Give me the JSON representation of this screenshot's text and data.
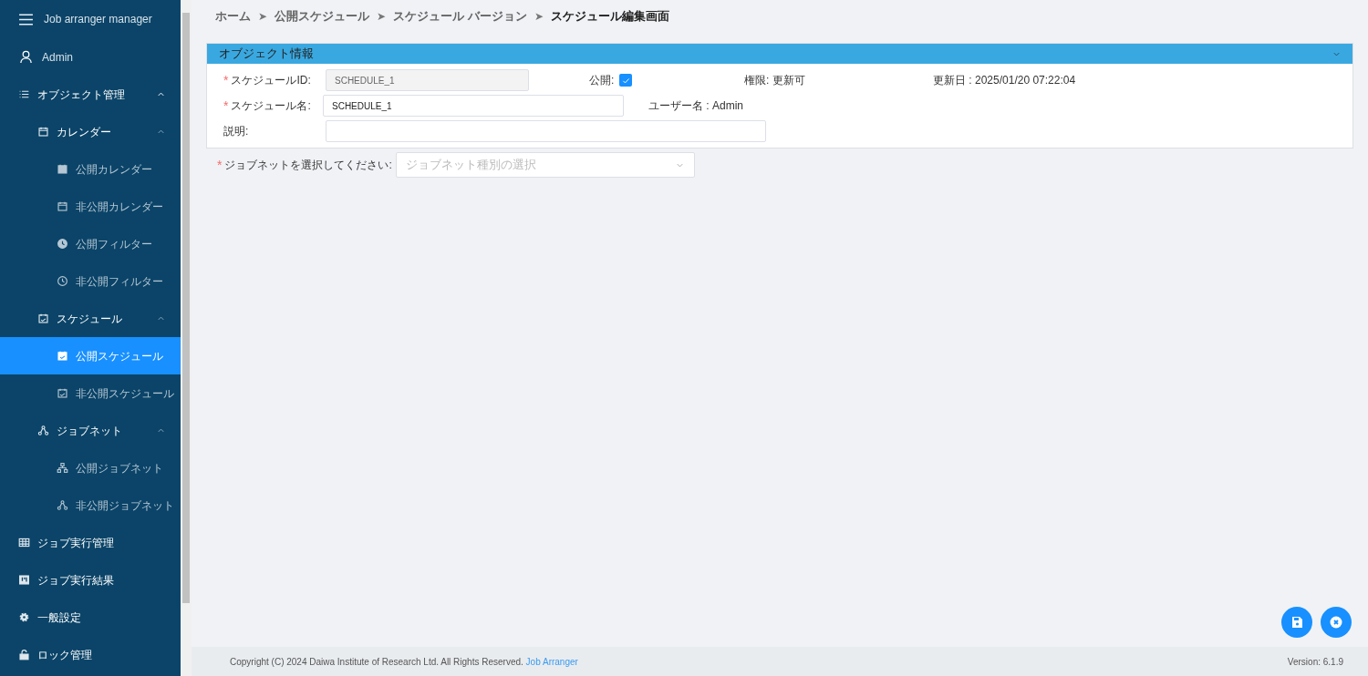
{
  "sidebar": {
    "title": "Job arranger manager",
    "user": "Admin",
    "items": [
      {
        "label": "オブジェクト管理",
        "kind": "list",
        "expanded": true,
        "selected": false,
        "children": [
          {
            "label": "カレンダー",
            "kind": "calendar",
            "expanded": true,
            "selected": false,
            "children": [
              {
                "label": "公開カレンダー",
                "kind": "calendar-filled",
                "selected": false
              },
              {
                "label": "非公開カレンダー",
                "kind": "calendar",
                "selected": false
              },
              {
                "label": "公開フィルター",
                "kind": "clock-filled",
                "selected": false
              },
              {
                "label": "非公開フィルター",
                "kind": "clock",
                "selected": false
              }
            ]
          },
          {
            "label": "スケジュール",
            "kind": "schedule",
            "expanded": true,
            "selected": false,
            "children": [
              {
                "label": "公開スケジュール",
                "kind": "schedule-filled",
                "selected": true
              },
              {
                "label": "非公開スケジュール",
                "kind": "schedule",
                "selected": false
              }
            ]
          },
          {
            "label": "ジョブネット",
            "kind": "network",
            "expanded": true,
            "selected": false,
            "children": [
              {
                "label": "公開ジョブネット",
                "kind": "hierarchy",
                "selected": false
              },
              {
                "label": "非公開ジョブネット",
                "kind": "network",
                "selected": false
              }
            ]
          }
        ]
      },
      {
        "label": "ジョブ実行管理",
        "kind": "table",
        "selected": false
      },
      {
        "label": "ジョブ実行結果",
        "kind": "board",
        "selected": false
      },
      {
        "label": "一般設定",
        "kind": "gear",
        "selected": false
      },
      {
        "label": "ロック管理",
        "kind": "lock",
        "selected": false
      }
    ]
  },
  "breadcrumb": [
    {
      "label": "ホーム",
      "current": false
    },
    {
      "label": "公開スケジュール",
      "current": false
    },
    {
      "label": "スケジュール バージョン",
      "current": false
    },
    {
      "label": "スケジュール編集画面",
      "current": true
    }
  ],
  "breadcrumb_separator": "➤",
  "panel": {
    "title": "オブジェクト情報",
    "expanded": true,
    "schedule_id": {
      "mark": "*",
      "label": "スケジュールID:",
      "value": "SCHEDULE_1",
      "disabled": true
    },
    "public": {
      "label": "公開:",
      "checked": true
    },
    "permission": "権限: 更新可",
    "updated": "更新日 : 2025/01/20 07:22:04",
    "schedule_name": {
      "mark": "*",
      "label": "スケジュール名:",
      "value": "SCHEDULE_1",
      "disabled": false
    },
    "user_name": "ユーザー名 : Admin",
    "description": {
      "label": "説明:",
      "disabled": false
    }
  },
  "jobnet_select": {
    "mark": "*",
    "label": "ジョブネットを選択してください:",
    "placeholder": "ジョブネット種別の選択"
  },
  "fab_buttons": [
    {
      "kind": "save"
    },
    {
      "kind": "cancel"
    }
  ],
  "footer": {
    "copyright": "Copyright (C) 2024 Daiwa Institute of Research Ltd. All Rights Reserved.",
    "link": "Job Arranger",
    "version": "Version: 6.1.9"
  }
}
